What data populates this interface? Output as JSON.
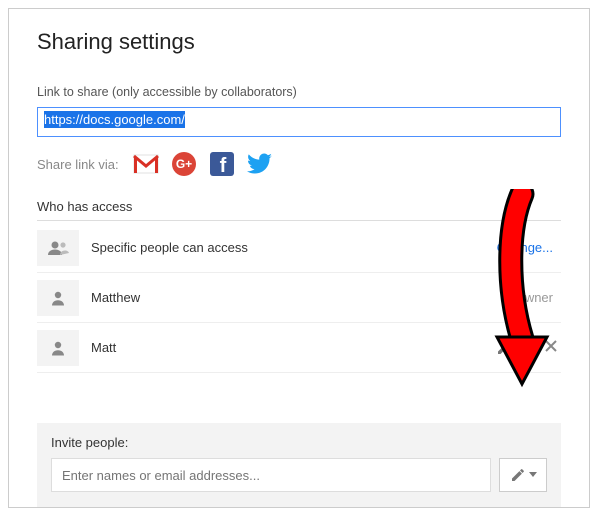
{
  "title": "Sharing settings",
  "link_label": "Link to share (only accessible by collaborators)",
  "link_value": "https://docs.google.com/",
  "share_via_label": "Share link via:",
  "share_icons": {
    "gmail": "gmail-icon",
    "gplus": "google-plus-icon",
    "facebook": "facebook-icon",
    "twitter": "twitter-icon"
  },
  "who_header": "Who has access",
  "access_summary": {
    "text": "Specific people can access",
    "action": "Change..."
  },
  "people": [
    {
      "name": "Matthew",
      "role": "Is owner",
      "removable": false,
      "editable": false
    },
    {
      "name": "Matt",
      "role": "",
      "removable": true,
      "editable": true
    }
  ],
  "invite": {
    "label": "Invite people:",
    "placeholder": "Enter names or email addresses..."
  },
  "colors": {
    "link_blue": "#1a73e8",
    "gmail_red": "#d93025",
    "gplus_red": "#db4437",
    "facebook_blue": "#3b5998",
    "twitter_blue": "#1da1f2",
    "arrow_red": "#ff0000"
  }
}
